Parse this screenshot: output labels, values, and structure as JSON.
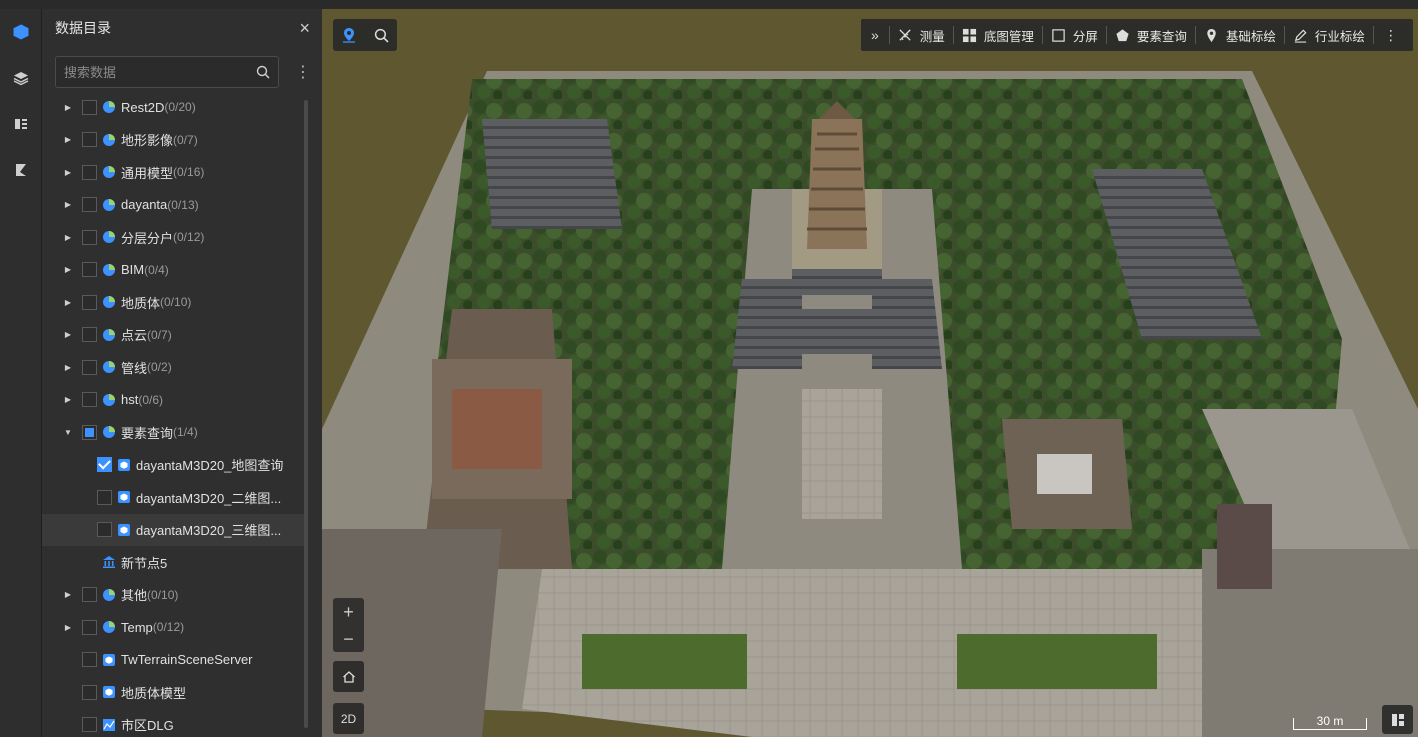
{
  "rail": {
    "items": [
      {
        "icon": "data-catalog-icon",
        "active": true
      },
      {
        "icon": "layers-icon",
        "active": false
      },
      {
        "icon": "list-icon",
        "active": false
      },
      {
        "icon": "analysis-icon",
        "active": false
      }
    ]
  },
  "panel": {
    "title": "数据目录",
    "close": "×",
    "search_placeholder": "搜索数据",
    "more": "⋮"
  },
  "tree": [
    {
      "label": "Rest2D",
      "count": "(0/20)",
      "expandable": true,
      "icon": "pie-icon",
      "state": "unchecked"
    },
    {
      "label": "地形影像",
      "count": "(0/7)",
      "expandable": true,
      "icon": "pie-icon",
      "state": "unchecked"
    },
    {
      "label": "通用模型",
      "count": "(0/16)",
      "expandable": true,
      "icon": "pie-icon",
      "state": "unchecked"
    },
    {
      "label": "dayanta",
      "count": "(0/13)",
      "expandable": true,
      "icon": "pie-icon",
      "state": "unchecked"
    },
    {
      "label": "分层分户",
      "count": "(0/12)",
      "expandable": true,
      "icon": "pie-icon",
      "state": "unchecked"
    },
    {
      "label": "BIM",
      "count": "(0/4)",
      "expandable": true,
      "icon": "pie-icon",
      "state": "unchecked"
    },
    {
      "label": "地质体",
      "count": "(0/10)",
      "expandable": true,
      "icon": "pie-icon",
      "state": "unchecked"
    },
    {
      "label": "点云",
      "count": "(0/7)",
      "expandable": true,
      "icon": "pie-icon",
      "state": "unchecked"
    },
    {
      "label": "管线",
      "count": "(0/2)",
      "expandable": true,
      "icon": "pie-icon",
      "state": "unchecked"
    },
    {
      "label": "hst",
      "count": "(0/6)",
      "expandable": true,
      "icon": "pie-icon",
      "state": "unchecked"
    },
    {
      "label": "要素查询",
      "count": "(1/4)",
      "expandable": true,
      "expanded": true,
      "icon": "pie-icon",
      "state": "indeterminate"
    },
    {
      "label": "dayantaM3D20_地图查询",
      "count": "",
      "child": true,
      "icon": "model-cube-icon",
      "state": "checked"
    },
    {
      "label": "dayantaM3D20_二维图...",
      "count": "",
      "child": true,
      "icon": "model-cube-icon",
      "state": "unchecked"
    },
    {
      "label": "dayantaM3D20_三维图...",
      "count": "",
      "child": true,
      "icon": "model-cube-icon",
      "state": "unchecked",
      "hover": true
    },
    {
      "label": "新节点5",
      "count": "",
      "expandable": false,
      "icon": "folder-node-icon",
      "state": "none"
    },
    {
      "label": "其他",
      "count": "(0/10)",
      "expandable": true,
      "icon": "pie-icon",
      "state": "unchecked"
    },
    {
      "label": "Temp",
      "count": "(0/12)",
      "expandable": true,
      "icon": "pie-icon",
      "state": "unchecked"
    },
    {
      "label": "TwTerrainSceneServer",
      "count": "",
      "expandable": false,
      "icon": "model-cube-icon",
      "state": "unchecked"
    },
    {
      "label": "地质体模型",
      "count": "",
      "expandable": false,
      "icon": "model-cube-icon",
      "state": "unchecked"
    },
    {
      "label": "市区DLG",
      "count": "",
      "expandable": false,
      "icon": "map-doc-icon",
      "state": "unchecked"
    }
  ],
  "toolbar": {
    "collapse": "»",
    "items": [
      {
        "label": "测量",
        "icon": "measure-icon"
      },
      {
        "label": "底图管理",
        "icon": "grid-icon"
      },
      {
        "label": "分屏",
        "icon": "split-screen-icon"
      },
      {
        "label": "要素查询",
        "icon": "pentagon-icon"
      },
      {
        "label": "基础标绘",
        "icon": "pin-icon"
      },
      {
        "label": "行业标绘",
        "icon": "pen-icon"
      }
    ],
    "more": "⋮"
  },
  "map_controls": {
    "zoom_in": "+",
    "zoom_out": "−",
    "home": "⌂",
    "view_2d": "2D",
    "scale": "30 m"
  },
  "colors": {
    "accent": "#3c92ff",
    "panel_bg": "#2f2f2f",
    "terrain": "#5f5730"
  }
}
